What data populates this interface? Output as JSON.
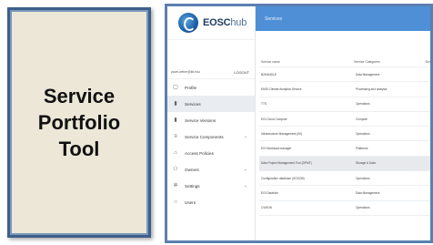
{
  "card": {
    "title": "Service Portfolio Tool"
  },
  "app": {
    "logo_main": "EOSC",
    "logo_sub": "hub",
    "header_title": "Services"
  },
  "user": {
    "email": "pavel.weber@kit.edu",
    "logout_label": "LOGOUT"
  },
  "sidebar": {
    "items": [
      {
        "label": "Profile",
        "icon": "user-icon",
        "active": false,
        "expandable": false
      },
      {
        "label": "Services",
        "icon": "book-icon",
        "active": true,
        "expandable": false
      },
      {
        "label": "Service Versions",
        "icon": "file-icon",
        "active": false,
        "expandable": false
      },
      {
        "label": "Service Components",
        "icon": "list-icon",
        "active": false,
        "expandable": true
      },
      {
        "label": "Access Policies",
        "icon": "lock-icon",
        "active": false,
        "expandable": false
      },
      {
        "label": "Owners",
        "icon": "users-icon",
        "active": false,
        "expandable": true
      },
      {
        "label": "Settings",
        "icon": "gear-icon",
        "active": false,
        "expandable": true
      },
      {
        "label": "Users",
        "icon": "person-icon",
        "active": false,
        "expandable": false
      }
    ]
  },
  "table": {
    "columns": [
      "Service name",
      "Service Categories",
      "Ser"
    ],
    "rows": [
      {
        "name": "B2HANDLE",
        "category": "Data Management"
      },
      {
        "name": "EMIS Climate Analytics Service",
        "category": "Processing and analysis"
      },
      {
        "name": "TTS",
        "category": "Operations"
      },
      {
        "name": "EGI Cloud Compute",
        "category": "Compute"
      },
      {
        "name": "Infrastructure Management (IM)",
        "category": "Operations"
      },
      {
        "name": "EGI Workload manager",
        "category": "Platforms"
      },
      {
        "name": "Data Project Management Tool (DPMT)",
        "category": "Storage & Data",
        "highlighted": true
      },
      {
        "name": "Configuration database (GOCDB)",
        "category": "Operations"
      },
      {
        "name": "EGI DataHub",
        "category": "Data Management"
      },
      {
        "name": "CVMON",
        "category": "Operations"
      }
    ]
  },
  "colors": {
    "header_blue": "#4e8fd6",
    "frame_border": "#5b7fb0",
    "card_bg": "#ece7d7",
    "card_border": "#3d5f8a"
  }
}
